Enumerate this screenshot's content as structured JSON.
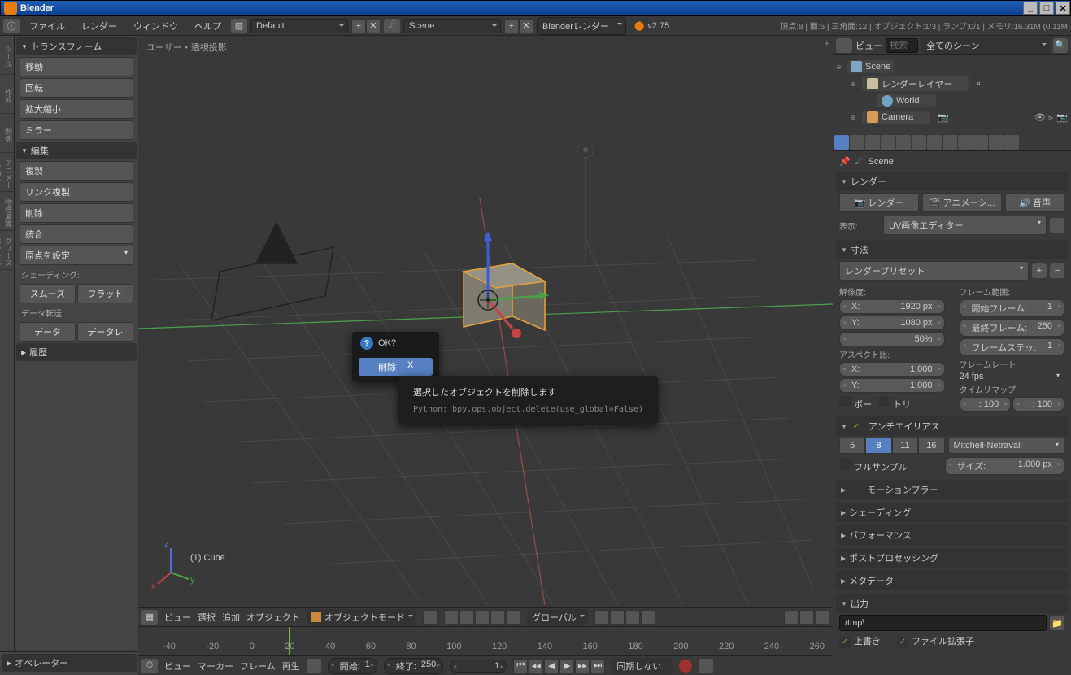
{
  "titlebar": {
    "app": "Blender"
  },
  "menubar": {
    "items": [
      "ファイル",
      "レンダー",
      "ウィンドウ",
      "ヘルプ"
    ],
    "layout": "Default",
    "scene": "Scene",
    "engine": "Blenderレンダー",
    "version": "v2.75",
    "stats": "頂点:8 | 面:6 | 三角面:12 | オブジェクト:1/3 | ランプ:0/1 | メモリ:16.31M (0.11M"
  },
  "tool_tabs": [
    "ツール",
    "作成",
    "関係",
    "アニメーション",
    "物理演算",
    "グリースペンシル"
  ],
  "toolshelf": {
    "transform": {
      "title": "トランスフォーム",
      "move": "移動",
      "rotate": "回転",
      "scale": "拡大縮小",
      "mirror": "ミラー"
    },
    "edit": {
      "title": "編集",
      "dup": "複製",
      "linkdup": "リンク複製",
      "del": "削除",
      "join": "統合",
      "origin": "原点を設定"
    },
    "shading": {
      "title": "シェーディング:",
      "smooth": "スムーズ",
      "flat": "フラット"
    },
    "datatrans": {
      "title": "データ転送:",
      "data": "データ",
      "datalayout": "データレ"
    },
    "history": {
      "title": "履歴"
    }
  },
  "operator": {
    "title": "オペレーター"
  },
  "viewport": {
    "label": "ユーザー・透視投影",
    "object": "(1) Cube"
  },
  "vp_header": {
    "view": "ビュー",
    "select": "選択",
    "add": "追加",
    "object": "オブジェクト",
    "mode": "オブジェクトモード",
    "orient": "グローバル"
  },
  "popup": {
    "title": "OK?",
    "del": "削除",
    "shortcut": "X"
  },
  "tooltip": {
    "desc": "選択したオブジェクトを削除します",
    "py": "Python: bpy.ops.object.delete(use_global=False)"
  },
  "timeline": {
    "ticks": [
      "-40",
      "-20",
      "0",
      "20",
      "40",
      "60",
      "80",
      "100",
      "120",
      "140",
      "160",
      "180",
      "200",
      "220",
      "240",
      "260"
    ],
    "view": "ビュー",
    "marker": "マーカー",
    "frame": "フレーム",
    "playback": "再生",
    "start_lbl": "開始:",
    "start": "1",
    "end_lbl": "終了:",
    "end": "250",
    "cur": "1",
    "sync": "同期しない"
  },
  "outliner": {
    "mode": "ビュー",
    "search_ph": "検索",
    "filter": "全てのシーン",
    "scene": "Scene",
    "renderlayers": "レンダーレイヤー",
    "world": "World",
    "camera": "Camera"
  },
  "breadcrumb": {
    "scene": "Scene"
  },
  "render": {
    "title": "レンダー",
    "render_btn": "レンダー",
    "anim_btn": "アニメーシ...",
    "audio_btn": "音声",
    "display_lbl": "表示:",
    "display_val": "UV画像エディター"
  },
  "dimensions": {
    "title": "寸法",
    "preset": "レンダープリセット",
    "res_lbl": "解像度:",
    "x_lbl": "X:",
    "x": "1920 px",
    "y_lbl": "Y:",
    "y": "1080 px",
    "pct": "50%",
    "aspect_lbl": "アスペクト比:",
    "ax": "1.000",
    "ay": "1.000",
    "border": "ボー",
    "crop": "トリ",
    "frange_lbl": "フレーム範囲:",
    "fstart_lbl": "開始フレーム:",
    "fstart": "1",
    "fend_lbl": "最終フレーム:",
    "fend": "250",
    "fstep_lbl": "フレームステッ:",
    "fstep": "1",
    "frate_lbl": "フレームレート:",
    "frate": "24 fps",
    "remap_lbl": "タイムリマップ:",
    "remap_old": ": 100",
    "remap_new": ": 100"
  },
  "aa": {
    "title": "アンチエイリアス",
    "s5": "5",
    "s8": "8",
    "s11": "11",
    "s16": "16",
    "filter": "Mitchell-Netravali",
    "full": "フルサンプル",
    "size_lbl": "サイズ:",
    "size": "1.000 px"
  },
  "sections": {
    "mblur": "モーションブラー",
    "shading": "シェーディング",
    "perf": "パフォーマンス",
    "post": "ポストプロセッシング",
    "meta": "メタデータ",
    "output": "出力"
  },
  "output": {
    "path": "/tmp\\",
    "overwrite": "上書き",
    "ext": "ファイル拡張子"
  }
}
